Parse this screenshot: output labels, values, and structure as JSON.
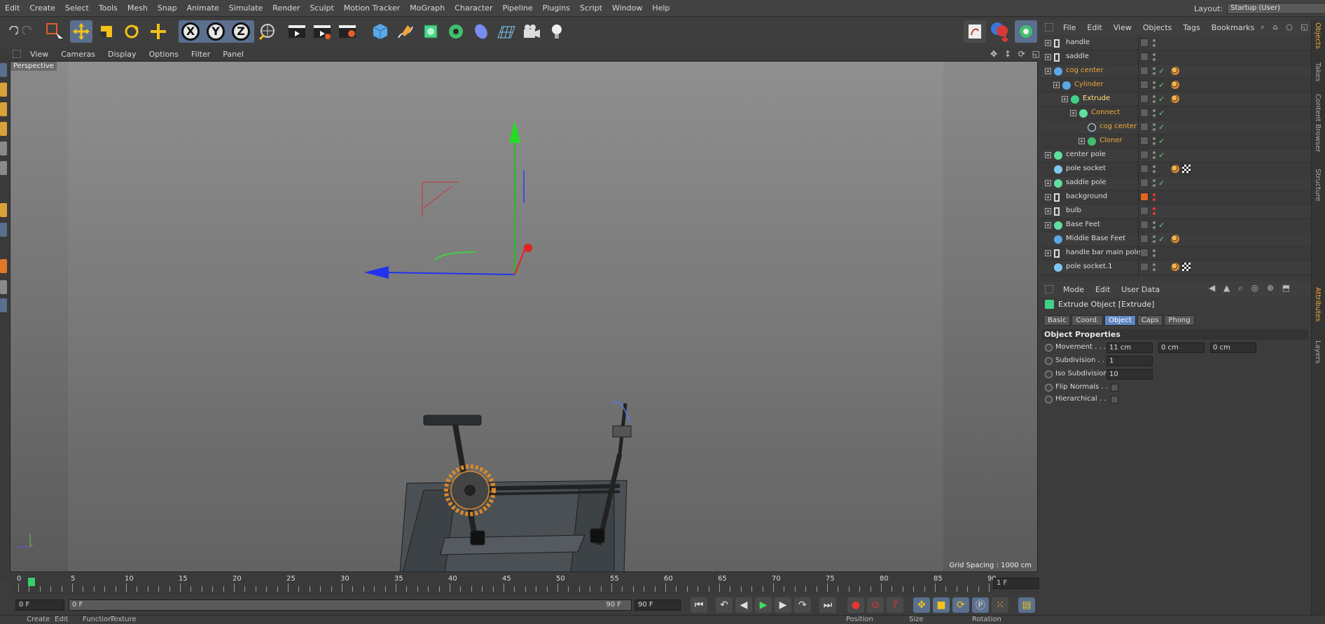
{
  "menubar": {
    "items": [
      "Edit",
      "Create",
      "Select",
      "Tools",
      "Mesh",
      "Snap",
      "Animate",
      "Simulate",
      "Render",
      "Sculpt",
      "Motion Tracker",
      "MoGraph",
      "Character",
      "Pipeline",
      "Plugins",
      "Script",
      "Window",
      "Help"
    ],
    "layout_label": "Layout:",
    "layout_value": "Startup (User)"
  },
  "toolbar": {
    "axis_x": "X",
    "axis_y": "Y",
    "axis_z": "Z"
  },
  "viewport": {
    "menu": [
      "View",
      "Cameras",
      "Display",
      "Options",
      "Filter",
      "Panel"
    ],
    "label": "Perspective",
    "grid_spacing": "Grid Spacing : 1000 cm"
  },
  "timeline": {
    "ticks": [
      "0",
      "5",
      "10",
      "15",
      "20",
      "25",
      "30",
      "35",
      "40",
      "45",
      "50",
      "55",
      "60",
      "65",
      "70",
      "75",
      "80",
      "85",
      "90"
    ],
    "current_frame": "1 F",
    "start_field": "0 F",
    "range_start": "0 F",
    "range_end": "90 F",
    "end_field": "90 F"
  },
  "bottomstrip": {
    "left": [
      "Create",
      "Edit",
      "Function",
      "Texture"
    ],
    "right": [
      "Position",
      "Size",
      "Rotation"
    ]
  },
  "object_manager": {
    "menu": [
      "File",
      "Edit",
      "View",
      "Objects",
      "Tags",
      "Bookmarks"
    ],
    "rows": [
      {
        "name": "handle",
        "indent": 0,
        "icon": "null",
        "state": "normal"
      },
      {
        "name": "saddle",
        "indent": 0,
        "icon": "null",
        "state": "normal"
      },
      {
        "name": "cog center",
        "indent": 0,
        "icon": "cylinder",
        "state": "selected"
      },
      {
        "name": "Cylinder",
        "indent": 1,
        "icon": "cylinder",
        "state": "selected"
      },
      {
        "name": "Extrude",
        "indent": 2,
        "icon": "extrude",
        "state": "active"
      },
      {
        "name": "Connect",
        "indent": 3,
        "icon": "connect",
        "state": "selected"
      },
      {
        "name": "cog center",
        "indent": 4,
        "icon": "circle",
        "state": "selected"
      },
      {
        "name": "Cloner",
        "indent": 4,
        "icon": "cloner",
        "state": "selected"
      },
      {
        "name": "center pole",
        "indent": 0,
        "icon": "sphere",
        "state": "normal"
      },
      {
        "name": "pole socket",
        "indent": 0,
        "icon": "light",
        "state": "normal"
      },
      {
        "name": "saddle pole",
        "indent": 0,
        "icon": "sphere",
        "state": "normal"
      },
      {
        "name": "background",
        "indent": 0,
        "icon": "null",
        "state": "normal"
      },
      {
        "name": "bulb",
        "indent": 0,
        "icon": "null",
        "state": "normal"
      },
      {
        "name": "Base Feet",
        "indent": 0,
        "icon": "sphere",
        "state": "normal"
      },
      {
        "name": "Middle Base Feet",
        "indent": 0,
        "icon": "cube",
        "state": "normal"
      },
      {
        "name": "handle bar main pole",
        "indent": 0,
        "icon": "null",
        "state": "normal"
      },
      {
        "name": "pole socket.1",
        "indent": 0,
        "icon": "light",
        "state": "normal"
      }
    ]
  },
  "right_tabs": [
    "Objects",
    "Takes",
    "Content Browser",
    "Structure"
  ],
  "right_tabs_lower": [
    "Attributes",
    "Layers"
  ],
  "attribute_manager": {
    "menu": [
      "Mode",
      "Edit",
      "User Data"
    ],
    "title": "Extrude Object [Extrude]",
    "tabs": [
      "Basic",
      "Coord.",
      "Object",
      "Caps",
      "Phong"
    ],
    "active_tab": "Object",
    "section": "Object Properties",
    "props": {
      "movement_label": "Movement . . .",
      "movement_x": "11 cm",
      "movement_y": "0 cm",
      "movement_z": "0 cm",
      "subdivision_label": "Subdivision . . .",
      "subdivision_value": "1",
      "iso_label": "Iso Subdivision",
      "iso_value": "10",
      "flip_label": "Flip Normals . .",
      "hier_label": "Hierarchical . ."
    }
  },
  "colors": {
    "selected_text": "#f2a93a",
    "active_text": "#ffe27a",
    "accent_blue": "#5f86c4"
  }
}
